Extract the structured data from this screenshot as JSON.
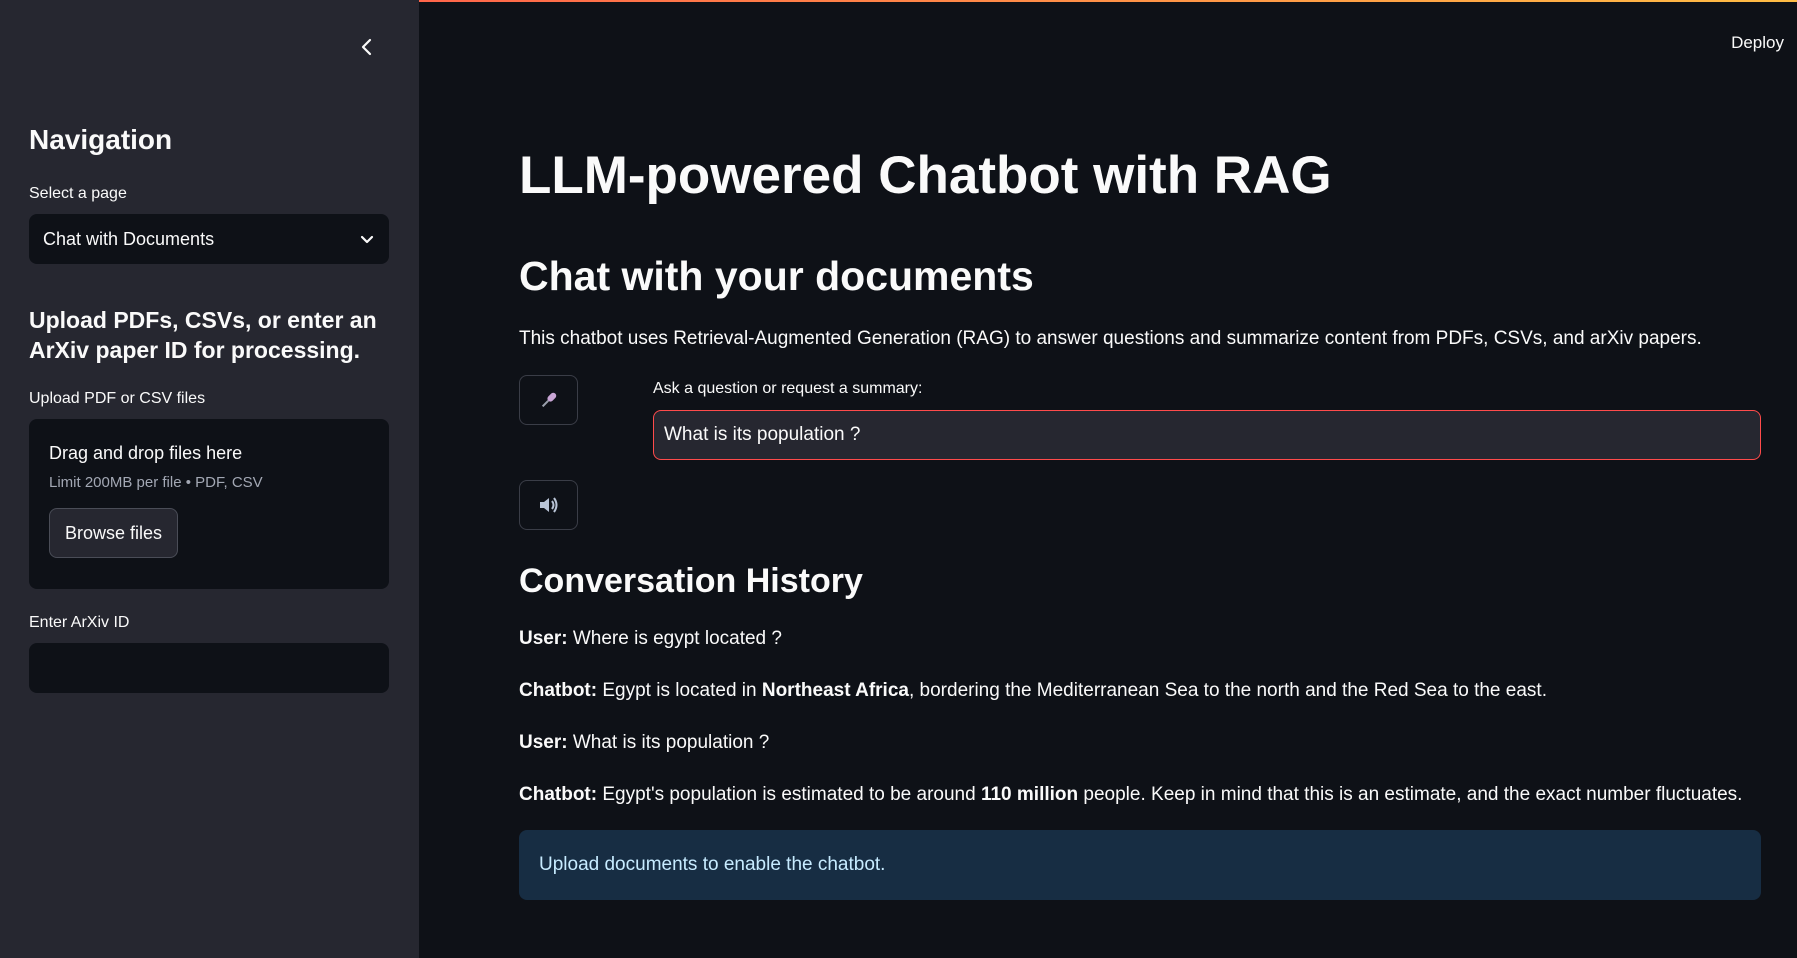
{
  "header": {
    "deploy_label": "Deploy"
  },
  "sidebar": {
    "heading": "Navigation",
    "select_label": "Select a page",
    "select_value": "Chat with Documents",
    "upload_heading": "Upload PDFs, CSVs, or enter an ArXiv paper ID for processing.",
    "uploader_label": "Upload PDF or CSV files",
    "dropzone_title": "Drag and drop files here",
    "dropzone_sub": "Limit 200MB per file • PDF, CSV",
    "browse_label": "Browse files",
    "arxiv_label": "Enter ArXiv ID",
    "arxiv_value": ""
  },
  "main": {
    "title": "LLM-powered Chatbot with RAG",
    "subtitle": "Chat with your documents",
    "description": "This chatbot uses Retrieval-Augmented Generation (RAG) to answer questions and summarize content from PDFs, CSVs, and arXiv papers.",
    "question_label": "Ask a question or request a summary:",
    "question_value": "What is its population ?",
    "history_heading": "Conversation History",
    "messages": [
      {
        "speaker": "User:",
        "parts": [
          "Where is egypt located ?"
        ]
      },
      {
        "speaker": "Chatbot:",
        "parts": [
          "Egypt is located in ",
          "Northeast Africa",
          ", bordering the Mediterranean Sea to the north and the Red Sea to the east."
        ]
      },
      {
        "speaker": "User:",
        "parts": [
          "What is its population ?"
        ]
      },
      {
        "speaker": "Chatbot:",
        "parts": [
          "Egypt's population is estimated to be around ",
          "110 million",
          " people. Keep in mind that this is an estimate, and the exact number fluctuates."
        ]
      }
    ],
    "info_text": "Upload documents to enable the chatbot."
  },
  "icons": [
    "chevron-left-icon",
    "chevron-down-icon",
    "microphone-icon",
    "speaker-icon"
  ],
  "colors": {
    "accent": "#ff4b4b",
    "sidebar_bg": "#262730",
    "main_bg": "#0e1117",
    "info_bg": "#172d43",
    "info_text": "#c7ebff"
  }
}
